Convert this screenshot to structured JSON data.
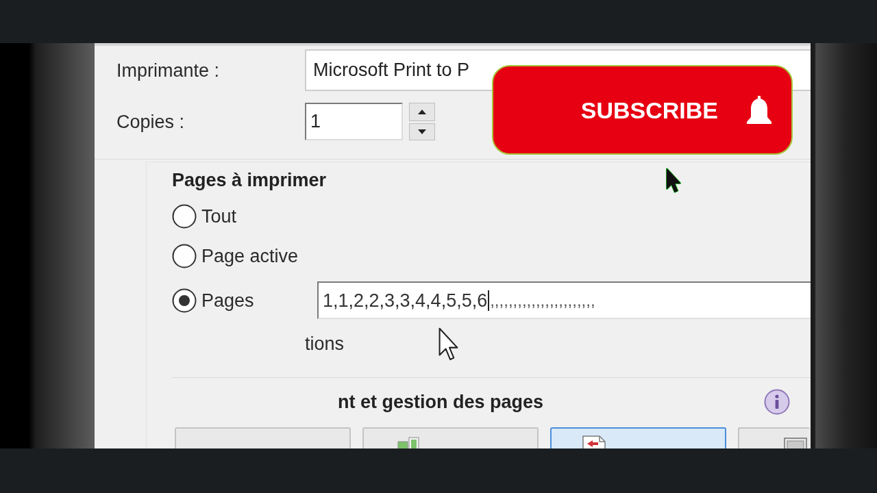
{
  "printer": {
    "label": "Imprimante :",
    "value": "Microsoft Print to P"
  },
  "copies": {
    "label": "Copies :",
    "value": "1"
  },
  "pages_group": {
    "title": "Pages à imprimer",
    "options": [
      {
        "label": "Tout",
        "selected": false
      },
      {
        "label": "Page active",
        "selected": false
      },
      {
        "label": "Pages",
        "selected": true
      }
    ],
    "pages_field": {
      "value": "1,1,2,2,3,3,4,4,5,5,6",
      "after_caret": ",,,,,,,,,,,,,,,,,,,,,,,"
    },
    "more_text": "tions"
  },
  "sizing_section": {
    "title": "nt et gestion des pages",
    "buttons": [
      {
        "selected": false
      },
      {
        "selected": false
      },
      {
        "selected": true
      },
      {
        "selected": false
      }
    ]
  },
  "overlay": {
    "subscribe_button": "SUBSCRIBE"
  }
}
